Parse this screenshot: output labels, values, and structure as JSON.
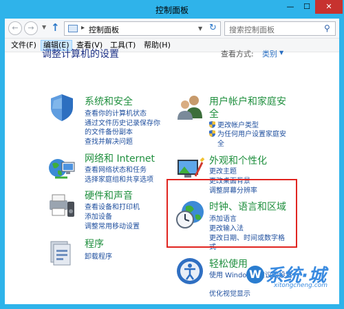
{
  "window": {
    "title": "控制面板",
    "minimize_glyph": "—",
    "maximize_glyph": "☐",
    "close_glyph": "✕"
  },
  "nav": {
    "back_glyph": "←",
    "forward_glyph": "→",
    "up_glyph": "↑",
    "address_text": "控制面板",
    "address_separator": "▸",
    "refresh_glyph": "↻",
    "search_placeholder": "搜索控制面板",
    "search_glyph": "⚲"
  },
  "menu": {
    "file": "文件(F)",
    "edit": "编辑(E)",
    "view": "查看(V)",
    "tools": "工具(T)",
    "help": "帮助(H)"
  },
  "content": {
    "title": "调整计算机的设置",
    "view_by_label": "查看方式:",
    "view_by_value": "类别",
    "view_by_arrow": "▼"
  },
  "categories": {
    "system": {
      "title": "系统和安全",
      "links": [
        "查看你的计算机状态",
        "通过文件历史记录保存你",
        "的文件备份副本",
        "查找并解决问题"
      ]
    },
    "network": {
      "title": "网络和 Internet",
      "links": [
        "查看网络状态和任务",
        "选择家庭组和共享选项"
      ]
    },
    "hardware": {
      "title": "硬件和声音",
      "links": [
        "查看设备和打印机",
        "添加设备",
        "调整常用移动设置"
      ]
    },
    "programs": {
      "title": "程序",
      "links": [
        "卸载程序"
      ]
    },
    "users": {
      "title_line1": "用户帐户和家庭安",
      "title_line2": "全",
      "links": [
        "更改帐户类型",
        "为任何用户设置家庭安",
        "全"
      ]
    },
    "appearance": {
      "title": "外观和个性化",
      "links": [
        "更改主题",
        "更改桌面背景",
        "调整屏幕分辨率"
      ]
    },
    "clock": {
      "title": "时钟、语言和区域",
      "links": [
        "添加语言",
        "更改输入法",
        "更改日期、时间或数字格",
        "式"
      ]
    },
    "ease": {
      "title": "轻松使用",
      "links": [
        "使用 Windows 建议的设置",
        "优化视觉显示"
      ]
    }
  },
  "watermark": {
    "brand": "系统·城",
    "url": "xitongcheng.com"
  },
  "colors": {
    "frame": "#2fb3ea",
    "category_title": "#1f8f3e",
    "link": "#1f4f9e",
    "highlight_border": "#e0241f"
  }
}
